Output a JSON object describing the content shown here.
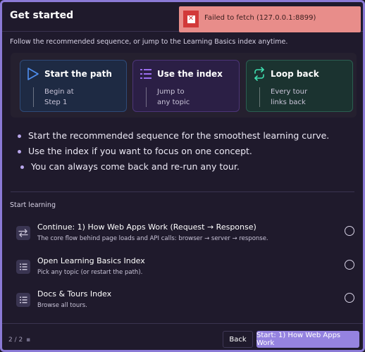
{
  "dialog": {
    "title": "Get started"
  },
  "toast": {
    "message": "Failed to fetch (127.0.0.1:8899)",
    "icon": "error-x-icon",
    "color": "#e88d8a"
  },
  "intro": "Follow the recommended sequence, or jump to the Learning Basics index anytime.",
  "cards": [
    {
      "title": "Start the path",
      "desc": "Begin at\nStep 1",
      "icon": "play-outline-icon",
      "accent": "#4f8ff0"
    },
    {
      "title": "Use the index",
      "desc": "Jump to\nany topic",
      "icon": "list-icon",
      "accent": "#9b6ef0"
    },
    {
      "title": "Loop back",
      "desc": "Every tour\nlinks back",
      "icon": "loop-arrows-icon",
      "accent": "#3fe0b0"
    }
  ],
  "bullets": [
    "Start the recommended sequence for the smoothest learning curve.",
    "Use the index if you want to focus on one concept.",
    "You can always come back and re-run any tour."
  ],
  "section": {
    "label": "Start learning"
  },
  "items": [
    {
      "title": "Continue: 1) How Web Apps Work (Request → Response)",
      "sub": "The core flow behind page loads and API calls: browser → server → response.",
      "icon": "swap-arrows-icon"
    },
    {
      "title": "Open Learning Basics Index",
      "sub": "Pick any topic (or restart the path).",
      "icon": "list-icon"
    },
    {
      "title": "Docs & Tours Index",
      "sub": "Browse all tours.",
      "icon": "list-icon"
    }
  ],
  "footer": {
    "pager": "2 / 2",
    "back_label": "Back",
    "primary_label": "Start: 1) How Web Apps Work",
    "primary_color": "#9583e0"
  }
}
